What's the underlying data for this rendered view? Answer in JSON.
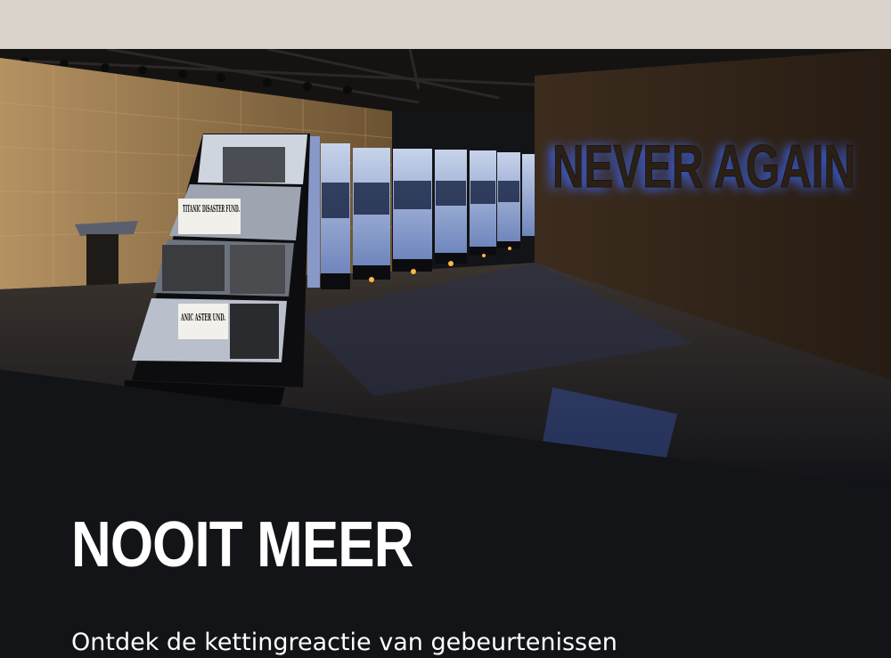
{
  "hero": {
    "photo_texts": {
      "wall_sign": "NEVER AGAIN",
      "panel_caption_top": "TITANIC DISASTER FUND.",
      "panel_caption_bottom": "ANIC ASTER UND."
    }
  },
  "main": {
    "heading": "NOOIT MEER",
    "intro": "Ontdek de kettingreactie van gebeurtenissen"
  }
}
